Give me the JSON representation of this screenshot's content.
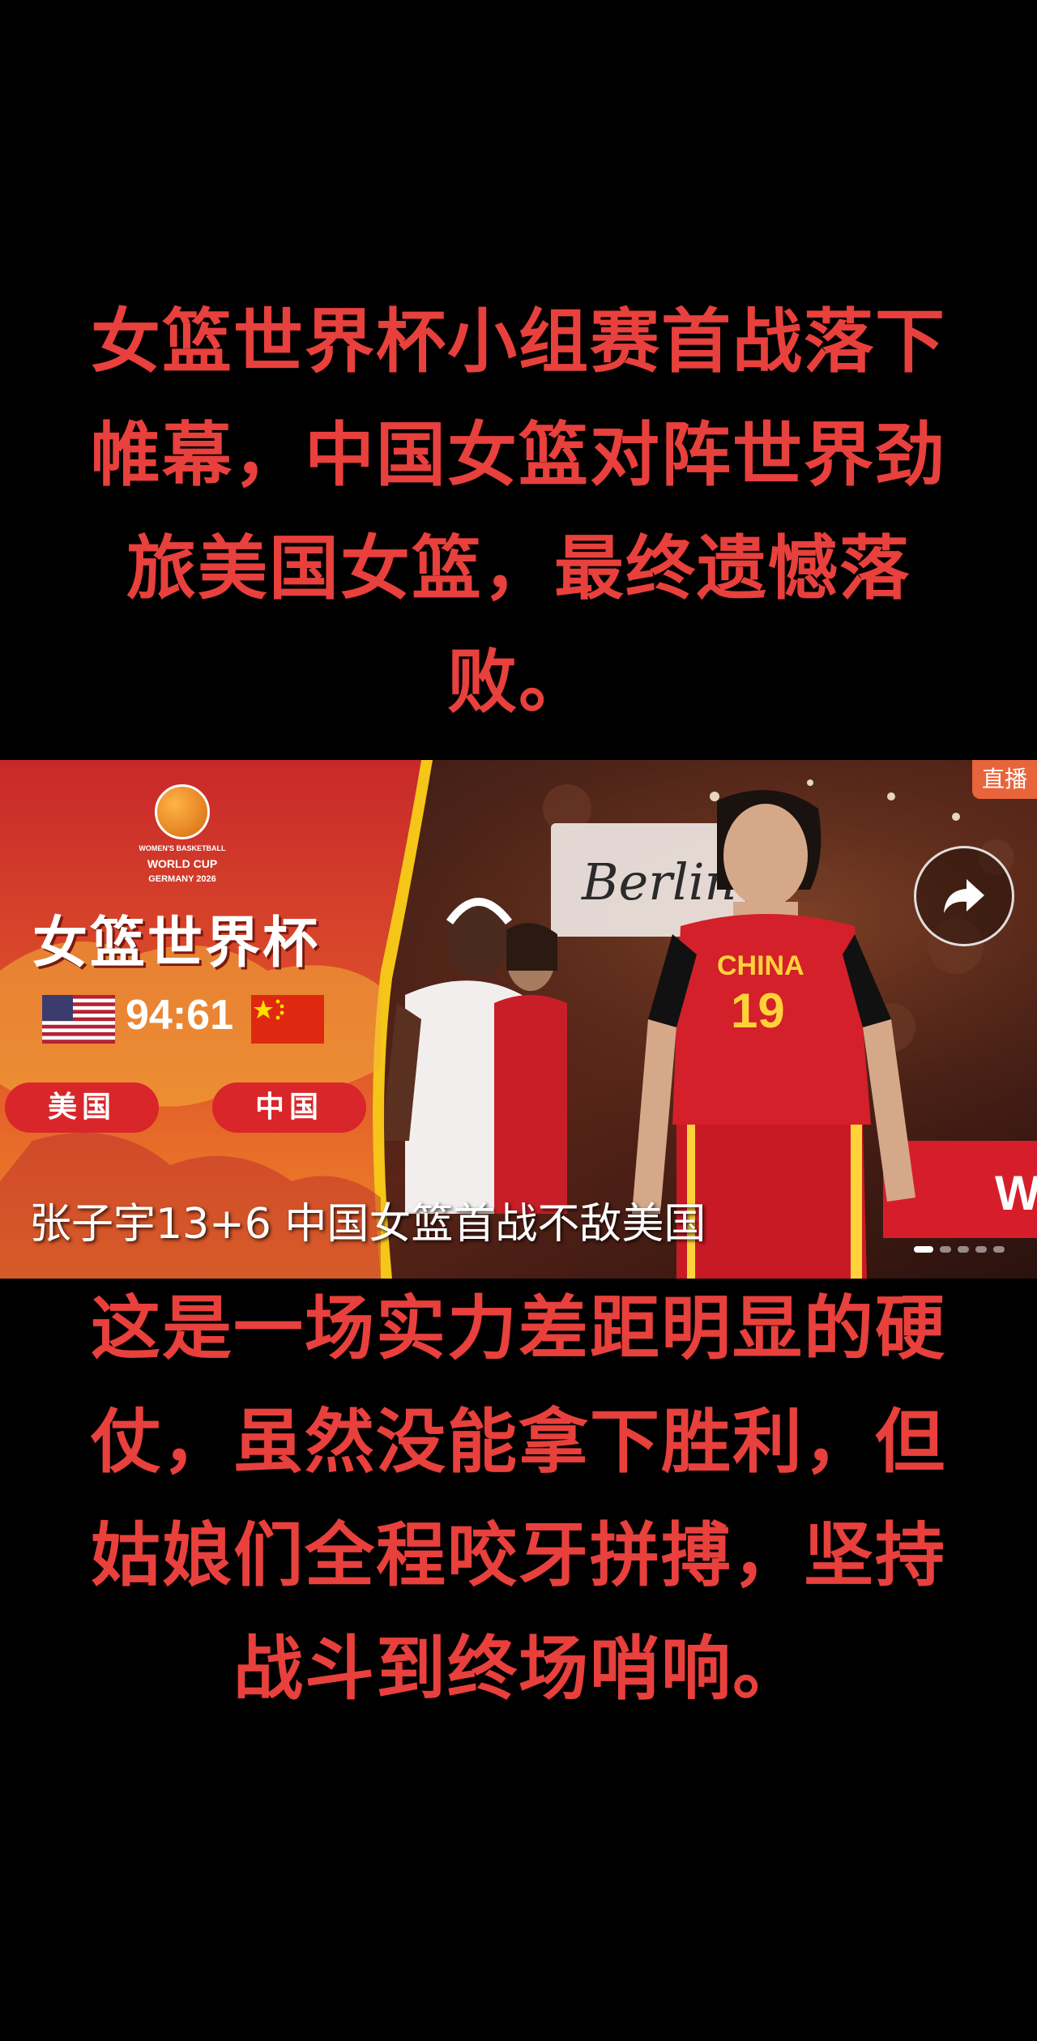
{
  "headline": "女篮世界杯小组赛首战落下帷幕，中国女篮对阵世界劲旅美国女篮，最终遗憾落败。",
  "body_text": "这是一场实力差距明显的硬仗，虽然没能拿下胜利，但姑娘们全程咬牙拼搏，坚持战斗到终场哨响。",
  "video_card": {
    "logo_text": [
      "WOMEN'S BASKETBALL",
      "WORLD CUP",
      "GERMANY 2026"
    ],
    "event_title": "女篮世界杯",
    "score": "94:61",
    "team_left": "美国",
    "team_right": "中国",
    "live_badge": "直播",
    "caption": "张子宇13+6 中国女篮首战不敌美国",
    "banner_text": "Berlin",
    "jersey_text": "CHINA",
    "jersey_number": "19",
    "slides_total": 5,
    "slide_active": 1,
    "colors": {
      "accent_red": "#e8403c",
      "panel_red": "#c8282a",
      "panel_orange": "#f08a28",
      "stripe_yellow": "#f5c518",
      "jersey_red": "#d3202a",
      "jersey_yellow": "#ffd23a"
    }
  },
  "icons": [
    "share-arrow-icon",
    "basketball-logo-icon",
    "us-flag-icon",
    "china-flag-icon"
  ]
}
